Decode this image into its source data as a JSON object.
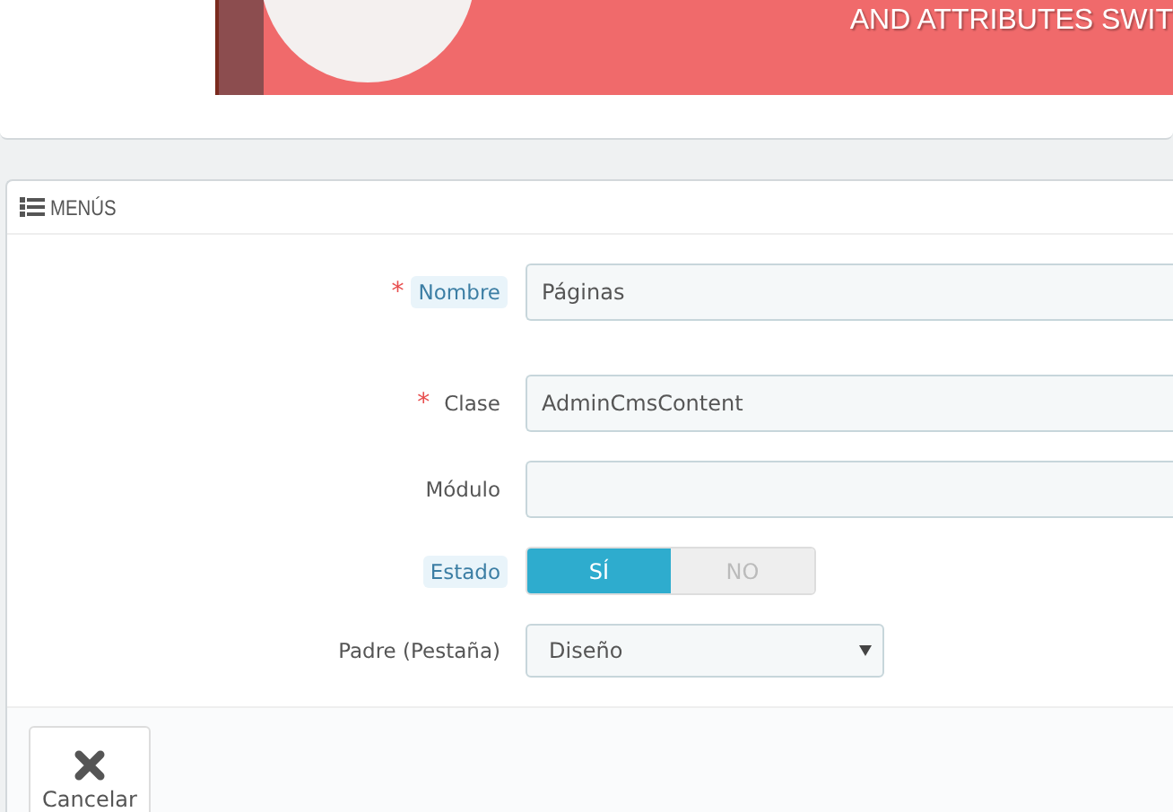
{
  "banner": {
    "text": "AND ATTRIBUTES SWIT"
  },
  "panel": {
    "title": "MENÚS",
    "fields": [
      {
        "kind": "text",
        "label": "Nombre",
        "required_mark": "*",
        "help": true,
        "value": "Páginas"
      },
      {
        "kind": "text",
        "label": "Clase",
        "required_mark": "*",
        "help": false,
        "value": "AdminCmsContent"
      },
      {
        "kind": "text",
        "label": "Módulo",
        "help": false
      },
      {
        "kind": "switch",
        "label": "Estado",
        "help": true,
        "options": [
          {
            "label": "SÍ",
            "selected": true
          },
          {
            "label": "NO",
            "selected": false
          }
        ]
      },
      {
        "kind": "select",
        "label": "Padre (Pestaña)",
        "help": false,
        "value": "Diseño"
      }
    ],
    "buttons": [
      {
        "label": "Cancelar"
      }
    ]
  }
}
